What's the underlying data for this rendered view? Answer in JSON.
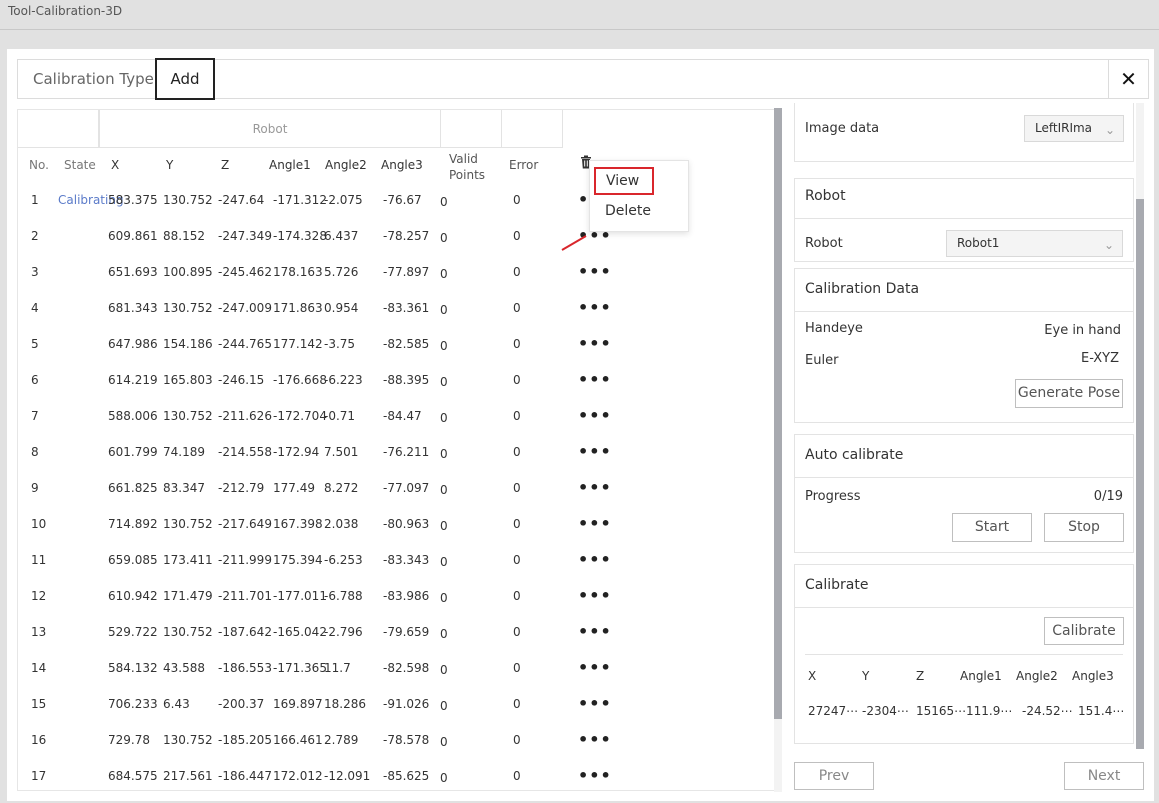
{
  "window": {
    "title": "Tool-Calibration-3D"
  },
  "tabs": {
    "calibration_type": "Calibration Type",
    "add": "Add",
    "close_glyph": "✕"
  },
  "table": {
    "group_header": "Robot",
    "headers": {
      "no": "No.",
      "state": "State",
      "x": "X",
      "y": "Y",
      "z": "Z",
      "a1": "Angle1",
      "a2": "Angle2",
      "a3": "Angle3",
      "valid": "Valid\nPoints",
      "error": "Error"
    },
    "rows": [
      {
        "no": "1",
        "state": "Calibrating",
        "x": "583.375",
        "y": "130.752",
        "z": "-247.64",
        "a1": "-171.312",
        "a2": "-2.075",
        "a3": "-76.67",
        "valid": "0",
        "error": "0"
      },
      {
        "no": "2",
        "state": "",
        "x": "609.861",
        "y": "88.152",
        "z": "-247.349",
        "a1": "-174.328",
        "a2": "6.437",
        "a3": "-78.257",
        "valid": "0",
        "error": "0"
      },
      {
        "no": "3",
        "state": "",
        "x": "651.693",
        "y": "100.895",
        "z": "-245.462",
        "a1": "178.163",
        "a2": "5.726",
        "a3": "-77.897",
        "valid": "0",
        "error": "0"
      },
      {
        "no": "4",
        "state": "",
        "x": "681.343",
        "y": "130.752",
        "z": "-247.009",
        "a1": "171.863",
        "a2": "0.954",
        "a3": "-83.361",
        "valid": "0",
        "error": "0"
      },
      {
        "no": "5",
        "state": "",
        "x": "647.986",
        "y": "154.186",
        "z": "-244.765",
        "a1": "177.142",
        "a2": "-3.75",
        "a3": "-82.585",
        "valid": "0",
        "error": "0"
      },
      {
        "no": "6",
        "state": "",
        "x": "614.219",
        "y": "165.803",
        "z": "-246.15",
        "a1": "-176.668",
        "a2": "-6.223",
        "a3": "-88.395",
        "valid": "0",
        "error": "0"
      },
      {
        "no": "7",
        "state": "",
        "x": "588.006",
        "y": "130.752",
        "z": "-211.626",
        "a1": "-172.704",
        "a2": "-0.71",
        "a3": "-84.47",
        "valid": "0",
        "error": "0"
      },
      {
        "no": "8",
        "state": "",
        "x": "601.799",
        "y": "74.189",
        "z": "-214.558",
        "a1": "-172.94",
        "a2": "7.501",
        "a3": "-76.211",
        "valid": "0",
        "error": "0"
      },
      {
        "no": "9",
        "state": "",
        "x": "661.825",
        "y": "83.347",
        "z": "-212.79",
        "a1": "177.49",
        "a2": "8.272",
        "a3": "-77.097",
        "valid": "0",
        "error": "0"
      },
      {
        "no": "10",
        "state": "",
        "x": "714.892",
        "y": "130.752",
        "z": "-217.649",
        "a1": "167.398",
        "a2": "2.038",
        "a3": "-80.963",
        "valid": "0",
        "error": "0"
      },
      {
        "no": "11",
        "state": "",
        "x": "659.085",
        "y": "173.411",
        "z": "-211.999",
        "a1": "175.394",
        "a2": "-6.253",
        "a3": "-83.343",
        "valid": "0",
        "error": "0"
      },
      {
        "no": "12",
        "state": "",
        "x": "610.942",
        "y": "171.479",
        "z": "-211.701",
        "a1": "-177.011",
        "a2": "-6.788",
        "a3": "-83.986",
        "valid": "0",
        "error": "0"
      },
      {
        "no": "13",
        "state": "",
        "x": "529.722",
        "y": "130.752",
        "z": "-187.642",
        "a1": "-165.042",
        "a2": "-2.796",
        "a3": "-79.659",
        "valid": "0",
        "error": "0"
      },
      {
        "no": "14",
        "state": "",
        "x": "584.132",
        "y": "43.588",
        "z": "-186.553",
        "a1": "-171.365",
        "a2": "11.7",
        "a3": "-82.598",
        "valid": "0",
        "error": "0"
      },
      {
        "no": "15",
        "state": "",
        "x": "706.233",
        "y": "6.43",
        "z": "-200.37",
        "a1": "169.897",
        "a2": "18.286",
        "a3": "-91.026",
        "valid": "0",
        "error": "0"
      },
      {
        "no": "16",
        "state": "",
        "x": "729.78",
        "y": "130.752",
        "z": "-185.205",
        "a1": "166.461",
        "a2": "2.789",
        "a3": "-78.578",
        "valid": "0",
        "error": "0"
      },
      {
        "no": "17",
        "state": "",
        "x": "684.575",
        "y": "217.561",
        "z": "-186.447",
        "a1": "172.012",
        "a2": "-12.091",
        "a3": "-85.625",
        "valid": "0",
        "error": "0"
      }
    ],
    "row_action_glyph": "•••"
  },
  "context_menu": {
    "view": "View",
    "delete": "Delete"
  },
  "image_section": {
    "label": "Image data",
    "value": "LeftIRIma"
  },
  "robot_section": {
    "title": "Robot",
    "label": "Robot",
    "value": "Robot1"
  },
  "calibration_data": {
    "title": "Calibration Data",
    "handeye_label": "Handeye",
    "handeye_value": "Eye in hand",
    "euler_label": "Euler",
    "euler_value": "E-XYZ",
    "generate_button": "Generate Pose"
  },
  "auto_calibrate": {
    "title": "Auto calibrate",
    "progress_label": "Progress",
    "progress_value": "0/19",
    "start_button": "Start",
    "stop_button": "Stop"
  },
  "calibrate": {
    "title": "Calibrate",
    "button": "Calibrate",
    "headers": [
      "X",
      "Y",
      "Z",
      "Angle1",
      "Angle2",
      "Angle3"
    ],
    "values": [
      "27247⋯",
      "-2304⋯",
      "15165⋯",
      "111.9⋯",
      "-24.52⋯",
      "151.4⋯"
    ]
  },
  "footer": {
    "prev": "Prev",
    "next": "Next"
  },
  "colors": {
    "accent_link": "#5b7bc9",
    "highlight": "#d9262c",
    "scroll_thumb": "#a8aab0"
  }
}
